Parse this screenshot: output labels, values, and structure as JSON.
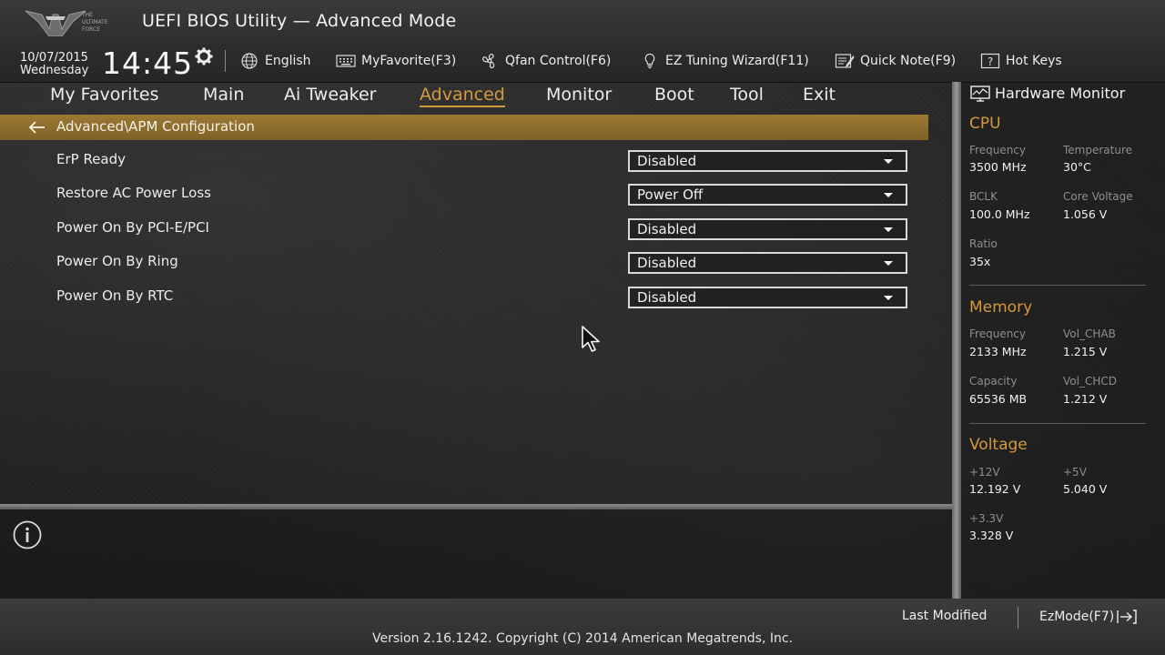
{
  "header": {
    "title": "UEFI BIOS Utility — Advanced Mode",
    "logo_text": [
      "THE",
      "ULTIMATE",
      "FORCE"
    ],
    "date": "10/07/2015",
    "weekday": "Wednesday",
    "time": "14:45",
    "settings_icon": "gear-icon"
  },
  "toolbar": [
    {
      "label": "English",
      "icon": "globe-icon"
    },
    {
      "label": "MyFavorite(F3)",
      "icon": "keyboard-icon"
    },
    {
      "label": "Qfan Control(F6)",
      "icon": "fan-icon"
    },
    {
      "label": "EZ Tuning Wizard(F11)",
      "icon": "lightbulb-icon"
    },
    {
      "label": "Quick Note(F9)",
      "icon": "note-icon"
    },
    {
      "label": "Hot Keys",
      "icon": "question-icon"
    }
  ],
  "nav": {
    "tabs": [
      "My Favorites",
      "Main",
      "Ai Tweaker",
      "Advanced",
      "Monitor",
      "Boot",
      "Tool",
      "Exit"
    ],
    "active": "Advanced",
    "active_color": "#d29a3c"
  },
  "breadcrumb": {
    "text": "Advanced\\APM Configuration",
    "back_icon": "arrow-left-icon",
    "color": "#8e6e2e"
  },
  "settings": [
    {
      "label": "ErP Ready",
      "value": "Disabled"
    },
    {
      "label": "Restore AC Power Loss",
      "value": "Power Off"
    },
    {
      "label": "Power On By PCI-E/PCI",
      "value": "Disabled"
    },
    {
      "label": "Power On By Ring",
      "value": "Disabled"
    },
    {
      "label": "Power On By RTC",
      "value": "Disabled"
    }
  ],
  "help": {
    "icon": "info-icon"
  },
  "hardware_monitor": {
    "title": "Hardware Monitor",
    "cpu": {
      "heading": "CPU",
      "frequency_label": "Frequency",
      "frequency": "3500 MHz",
      "temperature_label": "Temperature",
      "temperature": "30°C",
      "bclk_label": "BCLK",
      "bclk": "100.0 MHz",
      "core_voltage_label": "Core Voltage",
      "core_voltage": "1.056 V",
      "ratio_label": "Ratio",
      "ratio": "35x"
    },
    "memory": {
      "heading": "Memory",
      "frequency_label": "Frequency",
      "frequency": "2133 MHz",
      "vol_chab_label": "Vol_CHAB",
      "vol_chab": "1.215 V",
      "capacity_label": "Capacity",
      "capacity": "65536 MB",
      "vol_chcd_label": "Vol_CHCD",
      "vol_chcd": "1.212 V"
    },
    "voltage": {
      "heading": "Voltage",
      "v12_label": "+12V",
      "v12": "12.192 V",
      "v5_label": "+5V",
      "v5": "5.040 V",
      "v33_label": "+3.3V",
      "v33": "3.328 V"
    }
  },
  "footer": {
    "last_modified": "Last Modified",
    "ezmode": "EzMode(F7)",
    "ezmode_icon": "exit-icon",
    "version": "Version 2.16.1242. Copyright (C) 2014 American Megatrends, Inc."
  }
}
